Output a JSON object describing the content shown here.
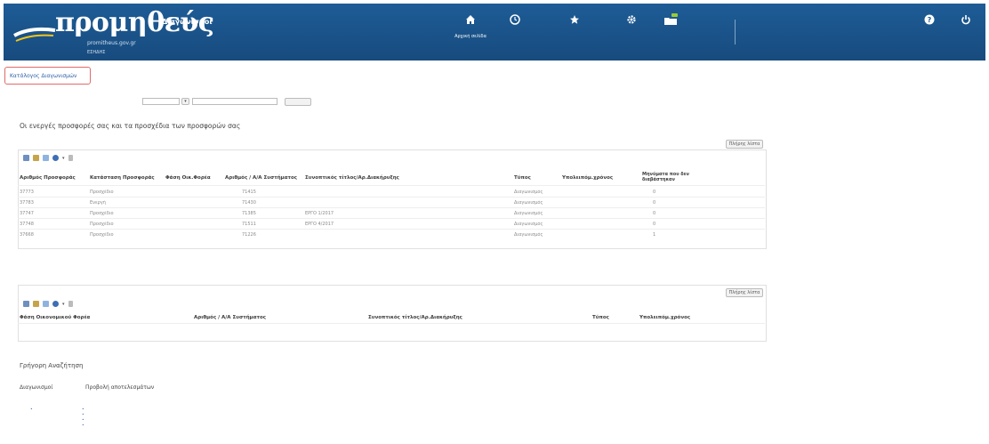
{
  "header": {
    "logo_text": "προμηθεύς",
    "logo_sub": "Διαγωνισμοί",
    "logo_url": "promitheus.gov.gr",
    "logo_dept": "ΕΣΗΔΗΣ",
    "nav": [
      {
        "label": "Αρχική σελίδα",
        "icon": "home-icon"
      },
      {
        "label": "",
        "icon": "clock-icon"
      },
      {
        "label": "",
        "icon": "star-icon"
      },
      {
        "label": "",
        "icon": "gear-icon"
      },
      {
        "label": "",
        "icon": "folder-icon"
      }
    ],
    "user_text": "",
    "help_label": "",
    "logout_label": ""
  },
  "breadcrumb": "Κατάλογος Διαγωνισμών",
  "filter": {
    "label": "",
    "select_value": "",
    "search_label": ""
  },
  "offers_section": {
    "note": "",
    "title": "Οι ενεργές προσφορές σας και τα προσχέδια των προσφορών σας",
    "hint": "",
    "full_list_button": "Πλήρης λίστα",
    "columns": [
      "Αριθμός Προσφοράς",
      "Κατάσταση Προσφοράς",
      "Φάση Οικ.Φορέα",
      "Αριθμός / Α/Α Συστήματος",
      "Συνοπτικός τίτλος/Αρ.Διακήρυξης",
      "Τύπος",
      "Υπολειπόμ.χρόνος",
      "Μηνύματα που δεν διαβάστηκαν"
    ],
    "rows": [
      [
        "37773",
        "Προσχέδιο",
        "",
        "71415",
        "",
        "Διαγωνισμός",
        "",
        "0"
      ],
      [
        "37783",
        "Ενεργή",
        "",
        "71430",
        "",
        "Διαγωνισμός",
        "",
        "0"
      ],
      [
        "37747",
        "Προσχέδιο",
        "",
        "71385",
        "ΕΡΓΟ 1/2017",
        "Διαγωνισμός",
        "",
        "0"
      ],
      [
        "37748",
        "Προσχέδιο",
        "",
        "71511",
        "ΕΡΓΟ 4/2017",
        "Διαγωνισμός",
        "",
        "0"
      ],
      [
        "37668",
        "Προσχέδιο",
        "",
        "71226",
        "",
        "Διαγωνισμός",
        "",
        "1"
      ]
    ]
  },
  "invitations_section": {
    "title": "",
    "full_list_button": "Πλήρης λίστα",
    "columns": [
      "Φάση Οικονομικού Φορέα",
      "Αριθμός / Α/Α Συστήματος",
      "Συνοπτικός τίτλος/Αρ.Διακήρυξης",
      "Τύπος",
      "Υπολειπόμ.χρόνος"
    ],
    "empty_text": ""
  },
  "quick_search": {
    "title": "Γρήγορη Αναζήτηση",
    "tabs": [
      "Διαγωνισμοί",
      "Προβολή αποτελεσμάτων"
    ],
    "tree_root": "",
    "tree_items": [
      "",
      "",
      "",
      ""
    ]
  },
  "colors": {
    "header_bg": "#1e5c96",
    "link": "#2f61a8",
    "breadcrumb_border": "#e36a6a"
  }
}
